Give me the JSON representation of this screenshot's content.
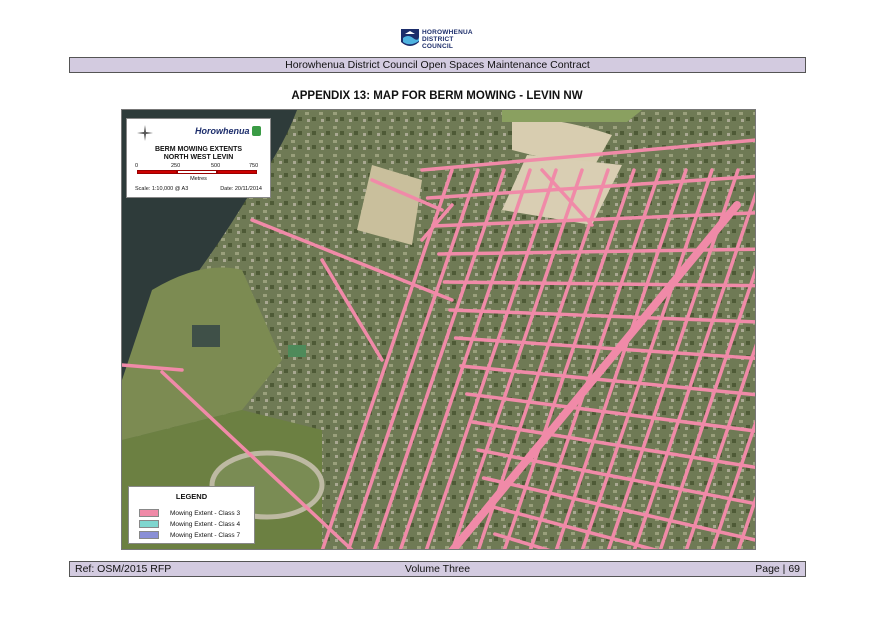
{
  "logo": {
    "lines": [
      "HOROWHENUA",
      "DISTRICT",
      "COUNCIL"
    ]
  },
  "header": {
    "title": "Horowhenua District Council Open Spaces Maintenance Contract"
  },
  "appendix_title": "APPENDIX 13:  MAP FOR BERM MOWING - LEVIN NW",
  "map": {
    "title_box": {
      "brand": "Horowhenua",
      "title_line1": "BERM MOWING EXTENTS",
      "title_line2": "NORTH WEST LEVIN",
      "scale_ticks": [
        "0",
        "250",
        "500",
        "750"
      ],
      "scale_units": "Metres",
      "scale": "Scale: 1:10,000 @ A3",
      "date": "Date: 20/11/2014"
    },
    "legend": {
      "title": "LEGEND",
      "items": [
        {
          "label": "Mowing Extent - Class 3",
          "color": "#f08aa8"
        },
        {
          "label": "Mowing Extent - Class 4",
          "color": "#7fd6cf"
        },
        {
          "label": "Mowing Extent - Class 7",
          "color": "#8a8fd6"
        }
      ]
    },
    "colors": {
      "berm": "#f08aa8",
      "lake": "#2e3b3a",
      "imagery": "#6b7c4c"
    }
  },
  "footer": {
    "ref": "Ref: OSM/2015 RFP",
    "volume": "Volume Three",
    "page": "Page | 69"
  }
}
